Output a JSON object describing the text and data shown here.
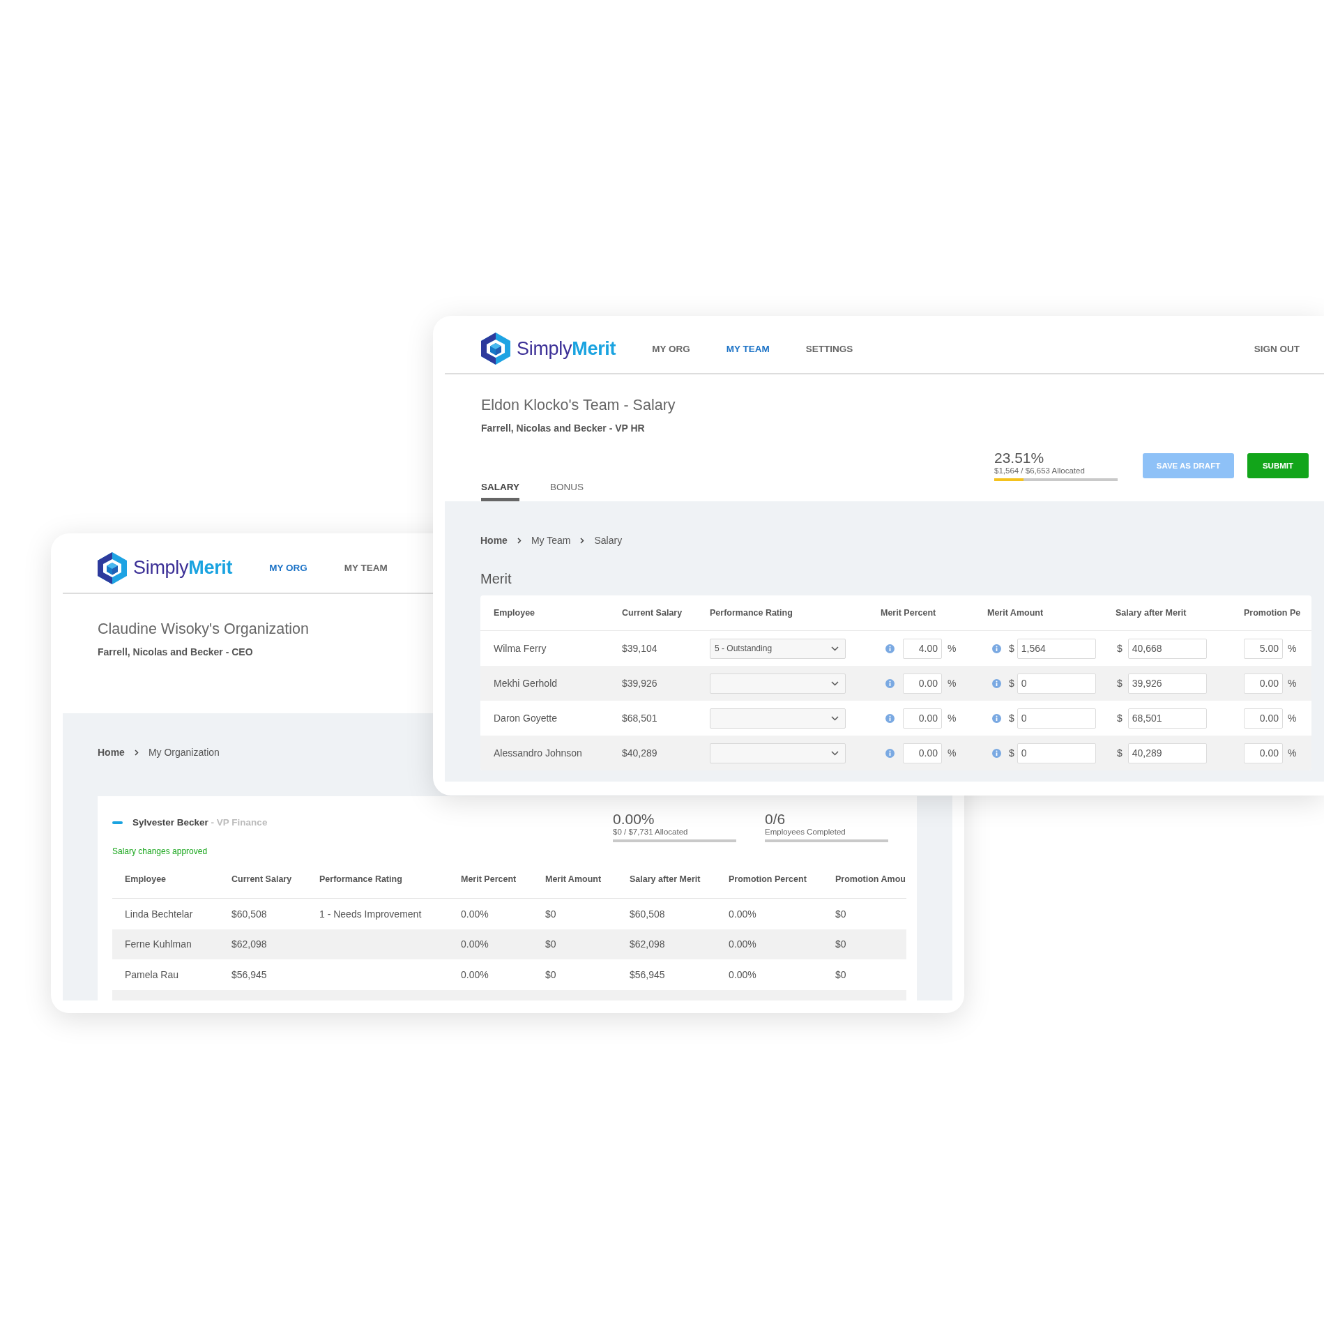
{
  "back_window": {
    "logo": "Simply**Merit**",
    "nav": [
      {
        "label": "MY ORG",
        "selected": true
      },
      {
        "label": "MY TEAM",
        "selected": false
      }
    ],
    "title": "Claudine Wisoky's Organization",
    "subtitle": "Farrell, Nicolas and Becker - CEO",
    "breadcrumb": [
      "Home",
      "My Organization"
    ],
    "group": {
      "name": "Sylvester Becker",
      "role": "- VP Finance",
      "status": "Salary changes approved",
      "stats": [
        {
          "value": "0.00%",
          "caption": "$0 / $7,731 Allocated"
        },
        {
          "value": "0/6",
          "caption": "Employees Completed"
        }
      ],
      "table": {
        "columns": [
          "Employee",
          "Current Salary",
          "Performance Rating",
          "Merit Percent",
          "Merit Amount",
          "Salary after Merit",
          "Promotion Percent",
          "Promotion Amou"
        ],
        "rows": [
          [
            "Linda Bechtelar",
            "$60,508",
            "1 - Needs Improvement",
            "0.00%",
            "$0",
            "$60,508",
            "0.00%",
            "$0"
          ],
          [
            "Ferne Kuhlman",
            "$62,098",
            "",
            "0.00%",
            "$0",
            "$62,098",
            "0.00%",
            "$0"
          ],
          [
            "Pamela Rau",
            "$56,945",
            "",
            "0.00%",
            "$0",
            "$56,945",
            "0.00%",
            "$0"
          ]
        ]
      }
    }
  },
  "front_window": {
    "logo": "Simply**Merit**",
    "nav": [
      {
        "label": "MY ORG",
        "selected": false
      },
      {
        "label": "MY TEAM",
        "selected": true
      },
      {
        "label": "SETTINGS",
        "selected": false
      }
    ],
    "sign_out": "SIGN OUT",
    "title": "Eldon Klocko's Team - Salary",
    "subtitle": "Farrell, Nicolas and Becker - VP HR",
    "allocation": {
      "value": "23.51%",
      "caption": "$1,564 / $6,653 Allocated",
      "level": 0.24
    },
    "buttons": [
      {
        "label": "SAVE AS DRAFT",
        "kind": "secondary"
      },
      {
        "label": "SUBMIT",
        "kind": "primary"
      }
    ],
    "tabs": [
      {
        "label": "SALARY",
        "selected": true
      },
      {
        "label": "BONUS",
        "selected": false
      }
    ],
    "breadcrumb": [
      "Home",
      "My Team",
      "Salary"
    ],
    "section_title": "Merit",
    "table": {
      "columns": [
        "Employee",
        "Current Salary",
        "Performance Rating",
        "Merit Percent",
        "Merit Amount",
        "Salary after Merit",
        "Promotion Pe"
      ],
      "rows": [
        {
          "employee": "Wilma Ferry",
          "current_salary": "$39,104",
          "performance_rating": "5 - Outstanding",
          "merit_percent": "4.00",
          "merit_unit": "%",
          "amount_currency": "$",
          "merit_amount": "1,564",
          "salary_currency": "$",
          "salary_after_merit": "40,668",
          "promotion_percent": "5.00",
          "promotion_unit": "%"
        },
        {
          "employee": "Mekhi Gerhold",
          "current_salary": "$39,926",
          "merit_percent": "0.00",
          "merit_unit": "%",
          "amount_currency": "$",
          "merit_amount": "0",
          "salary_currency": "$",
          "salary_after_merit": "39,926",
          "promotion_percent": "0.00",
          "promotion_unit": "%"
        },
        {
          "employee": "Daron Goyette",
          "current_salary": "$68,501",
          "merit_percent": "0.00",
          "merit_unit": "%",
          "amount_currency": "$",
          "merit_amount": "0",
          "salary_currency": "$",
          "salary_after_merit": "68,501",
          "promotion_percent": "0.00",
          "promotion_unit": "%"
        },
        {
          "employee": "Alessandro Johnson",
          "current_salary": "$40,289",
          "merit_percent": "0.00",
          "merit_unit": "%",
          "amount_currency": "$",
          "merit_amount": "0",
          "salary_currency": "$",
          "salary_after_merit": "40,289",
          "promotion_percent": "0.00",
          "promotion_unit": "%"
        }
      ]
    }
  }
}
